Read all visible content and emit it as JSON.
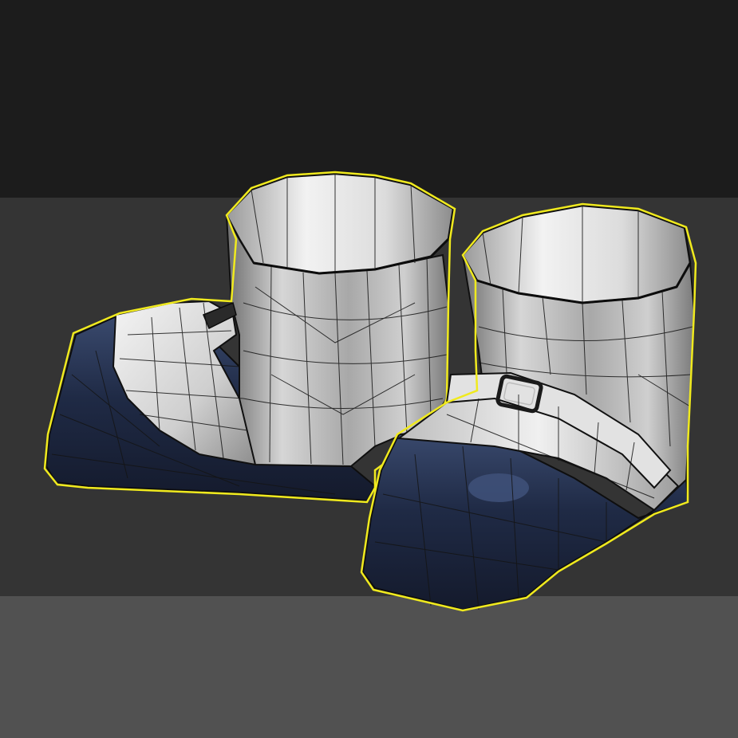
{
  "viewport": {
    "bands": [
      {
        "name": "top",
        "color": "#1c1c1c"
      },
      {
        "name": "middle",
        "color": "#343434"
      },
      {
        "name": "bottom",
        "color": "#515151"
      }
    ],
    "border_color": "#e9e400"
  },
  "model": {
    "selection_outline_color": "#f0ea1e",
    "upper_color": "#d9d9d9",
    "upper_shadow_color": "#8a8a8a",
    "inner_color": "#ededed",
    "sole_color": "#1d2640",
    "sole_highlight_color": "#3a4a6e",
    "wire_color": "#141414"
  },
  "icons": {
    "left_boot": "boot-mesh",
    "right_boot": "boot-mesh",
    "buckle": "square-buckle"
  }
}
